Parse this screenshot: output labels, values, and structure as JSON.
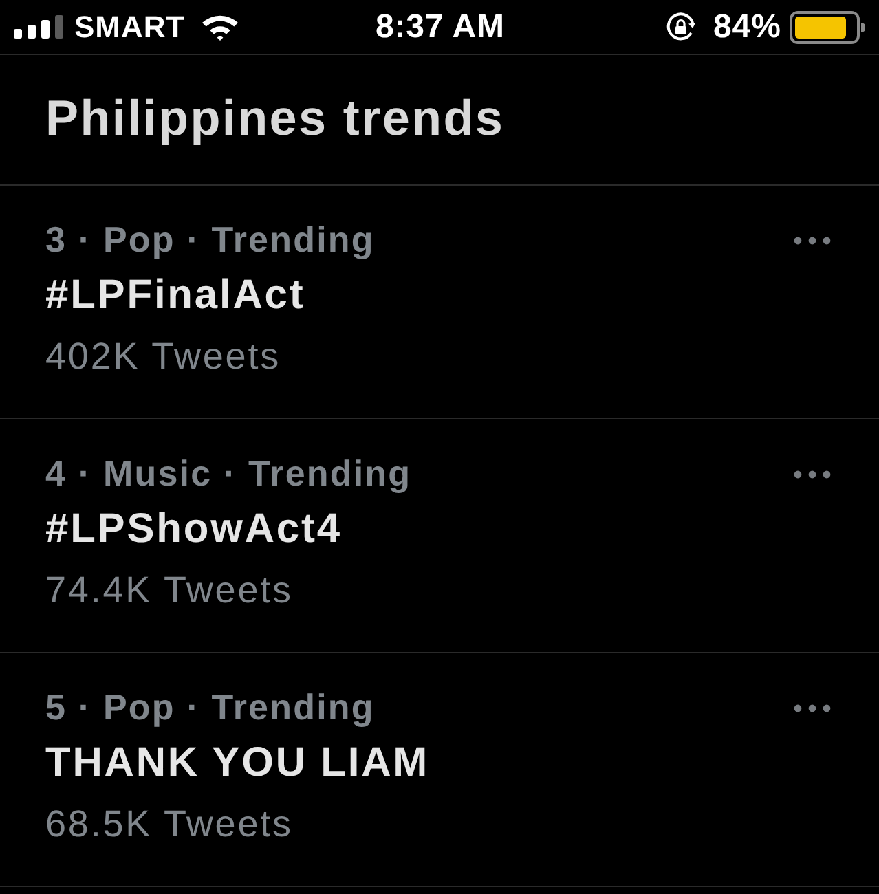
{
  "status_bar": {
    "carrier": "SMART",
    "time": "8:37 AM",
    "battery": "84%"
  },
  "header": {
    "title": "Philippines trends"
  },
  "trends": [
    {
      "meta": "3 · Pop · Trending",
      "name": "#LPFinalAct",
      "count": "402K Tweets"
    },
    {
      "meta": "4 · Music · Trending",
      "name": "#LPShowAct4",
      "count": "74.4K Tweets"
    },
    {
      "meta": "5 · Pop · Trending",
      "name": "THANK YOU LIAM",
      "count": "68.5K Tweets"
    }
  ]
}
